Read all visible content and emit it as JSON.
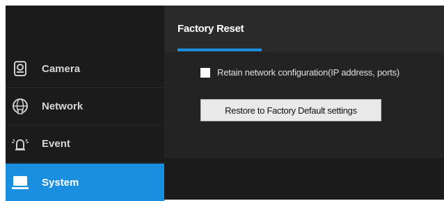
{
  "sidebar": {
    "items": [
      {
        "label": "Camera",
        "icon": "camera-icon",
        "active": false
      },
      {
        "label": "Network",
        "icon": "globe-icon",
        "active": false
      },
      {
        "label": "Event",
        "icon": "alarm-bell-icon",
        "active": false
      },
      {
        "label": "System",
        "icon": "monitor-icon",
        "active": true
      }
    ]
  },
  "main": {
    "tab_label": "Factory Reset",
    "retain_checkbox": {
      "label": "Retain network configuration(IP address, ports)",
      "checked": false
    },
    "restore_button_label": "Restore to Factory Default settings"
  },
  "colors": {
    "accent": "#1a8fe0",
    "sidebar_bg": "#1b1b1b",
    "header_bg": "#2a2a2a",
    "content_bg": "#232323"
  }
}
